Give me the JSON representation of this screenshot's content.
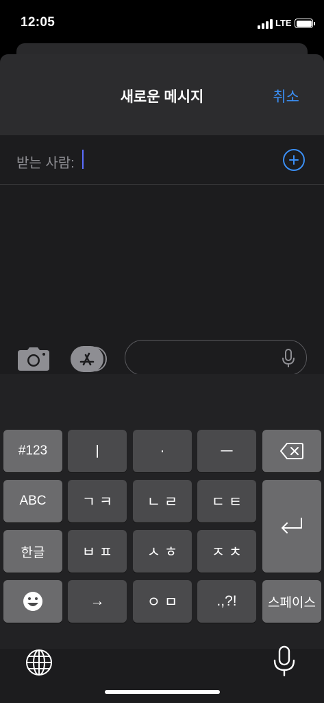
{
  "status_bar": {
    "time": "12:05",
    "network": "LTE",
    "battery_level": 1.0
  },
  "nav": {
    "title": "새로운 메시지",
    "cancel_label": "취소"
  },
  "recipient": {
    "label": "받는 사람:",
    "value": ""
  },
  "compose": {
    "message_text": ""
  },
  "app_strip": {
    "apps": [
      "photos-app-icon",
      "audio-message-icon",
      "memoji-icon",
      "memoji-stickers-icon",
      "activity-icon",
      "digital-touch-icon"
    ]
  },
  "keyboard": {
    "rows": [
      [
        "#123",
        "ㅣ",
        "·",
        "ㅡ",
        "delete-icon"
      ],
      [
        "ABC",
        "ㄱ ㅋ",
        "ㄴ ㄹ",
        "ㄷ ㅌ",
        "return-icon"
      ],
      [
        "한글",
        "ㅂ ㅍ",
        "ㅅ ㅎ",
        "ㅈ ㅊ"
      ],
      [
        "emoji-icon",
        "→",
        "ㅇ ㅁ",
        ".,?!",
        "스페이스"
      ]
    ],
    "labels": {
      "k123": "#123",
      "vowel_i": "ㅣ",
      "dot": "·",
      "vowel_eu": "ㅡ",
      "abc": "ABC",
      "giyeok": "ㄱ ㅋ",
      "nieun": "ㄴ ㄹ",
      "digeut": "ㄷ ㅌ",
      "hangul": "한글",
      "bieup": "ㅂ ㅍ",
      "siot": "ㅅ ㅎ",
      "jieut": "ㅈ ㅊ",
      "arrow": "→",
      "ieung": "ㅇ ㅁ",
      "punct": ".,?!",
      "space": "스페이스"
    }
  },
  "colors": {
    "accent": "#3b8ff5",
    "sheet_bg": "#1c1c1e",
    "nav_bg": "#2c2c2e",
    "key_bg": "#4a4a4c",
    "key_light": "#6b6b6d"
  }
}
